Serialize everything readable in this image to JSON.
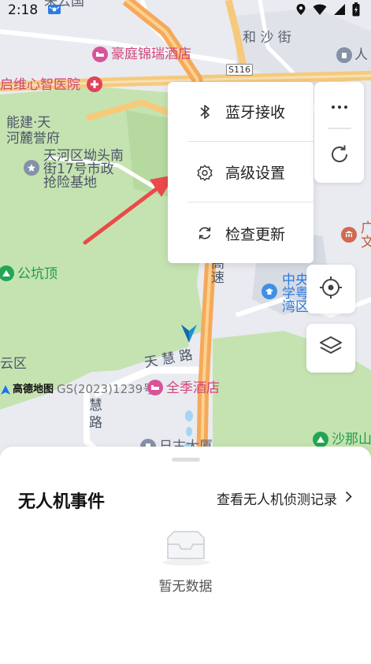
{
  "status_bar": {
    "time": "2:18"
  },
  "map": {
    "labels": {
      "hotel_top": "豪庭锦瑞酒店",
      "hospital": "启维心智医院",
      "road_s116": "S116",
      "street_hesha": "和 沙 街",
      "cut_top_right": "人",
      "nengjian_1": "能建·天",
      "nengjian_2": "河麓誉府",
      "base_1": "天河区坳头南",
      "base_2": "街17号市政",
      "base_3": "抢险基地",
      "peak": "公坑顶",
      "express_1": "高",
      "express_2": "速",
      "school_1": "中央",
      "school_2": "学粤",
      "school_3": "湾区",
      "cut_right_1": "广",
      "cut_right_2": "文",
      "tianhui_road": "天 慧 路",
      "park_cut": "云区",
      "amap_logo": "高德地图",
      "gs_number": "GS(2023)1239号",
      "hotel_bottom": "全季酒店",
      "hui_road_1": "慧",
      "hui_road_2": "路",
      "shanashan": "沙那山",
      "bottom_cut": "日古大厦",
      "top_cut": "来云国"
    },
    "colors": {
      "green": "#c5e3b1",
      "road_yellow": "#f7c97c",
      "road_orange": "#f6a95b",
      "accent_arrow": "#ea4a4a"
    }
  },
  "menu": {
    "items": [
      {
        "label": "蓝牙接收",
        "icon": "bluetooth-icon"
      },
      {
        "label": "高级设置",
        "icon": "settings-icon"
      },
      {
        "label": "检查更新",
        "icon": "refresh-icon"
      }
    ]
  },
  "side_buttons": {
    "more": "more-icon",
    "refresh": "refresh-icon",
    "locate": "locate-icon",
    "layers": "layers-icon"
  },
  "sheet": {
    "title": "无人机事件",
    "link_label": "查看无人机侦测记录",
    "empty_text": "暂无数据"
  }
}
